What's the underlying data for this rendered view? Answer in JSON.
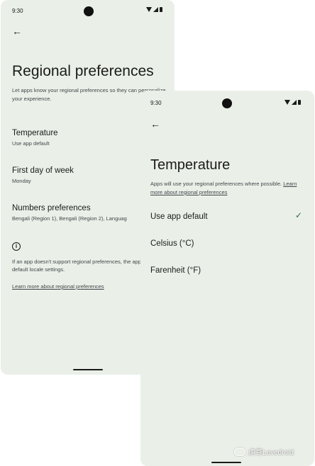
{
  "back_screen": {
    "status_time": "9:30",
    "title": "Regional preferences",
    "description": "Let apps know your regional preferences so they can personalize your experience.",
    "items": [
      {
        "title": "Temperature",
        "subtitle": "Use app default"
      },
      {
        "title": "First day of week",
        "subtitle": "Monday"
      },
      {
        "title": "Numbers preferences",
        "subtitle": "Bengali (Region 1), Bengali (Region 2), Languag"
      }
    ],
    "info_text": "If an app doesn't support regional preferences, the app will use its default locale settings.",
    "learn_link": "Learn more about regional preferences"
  },
  "front_screen": {
    "status_time": "9:30",
    "title": "Temperature",
    "description": "Apps will use your regional preferences where possible.",
    "learn_link": "Learn more about regional preferences",
    "options": [
      {
        "label": "Use app default",
        "selected": true
      },
      {
        "label": "Celsius (°C)",
        "selected": false
      },
      {
        "label": "Farenheit (°F)",
        "selected": false
      }
    ]
  },
  "icons": {
    "back": "back-arrow-icon",
    "info": "info-icon",
    "check": "check-icon",
    "wifi": "wifi-icon",
    "signal": "signal-icon",
    "battery": "battery-icon"
  },
  "watermark": "虎哥Lovedroid",
  "colors": {
    "background": "#eaefe8",
    "accent": "#2f6a4c"
  }
}
